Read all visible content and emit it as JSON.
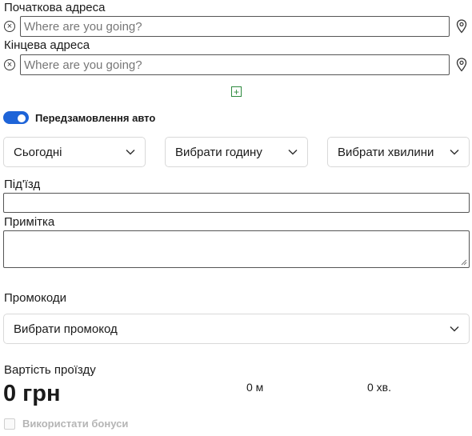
{
  "start_address": {
    "label": "Початкова адреса",
    "placeholder": "Where are you going?",
    "value": ""
  },
  "end_address": {
    "label": "Кінцева адреса",
    "placeholder": "Where are you going?",
    "value": ""
  },
  "add_stop": {
    "symbol": "+"
  },
  "preorder": {
    "label": "Передзамовлення авто",
    "enabled": true
  },
  "selects": {
    "day": "Сьогодні",
    "hour": "Вибрати годину",
    "minute": "Вибрати хвилини"
  },
  "entrance": {
    "label": "Під'їзд",
    "value": ""
  },
  "note": {
    "label": "Примітка",
    "value": ""
  },
  "promo": {
    "label": "Промокоди",
    "select_value": "Вибрати промокод"
  },
  "fare": {
    "label": "Вартість проїзду",
    "price": "0 грн",
    "distance": "0 м",
    "duration": "0 хв."
  },
  "bonuses": {
    "label": "Використати бонуси",
    "checked": false
  },
  "colors": {
    "accent": "#1e64d8",
    "add_green": "#2d8a3e"
  },
  "icons": [
    "clear-icon",
    "location-pin-icon",
    "plus-icon",
    "chevron-down-icon"
  ]
}
